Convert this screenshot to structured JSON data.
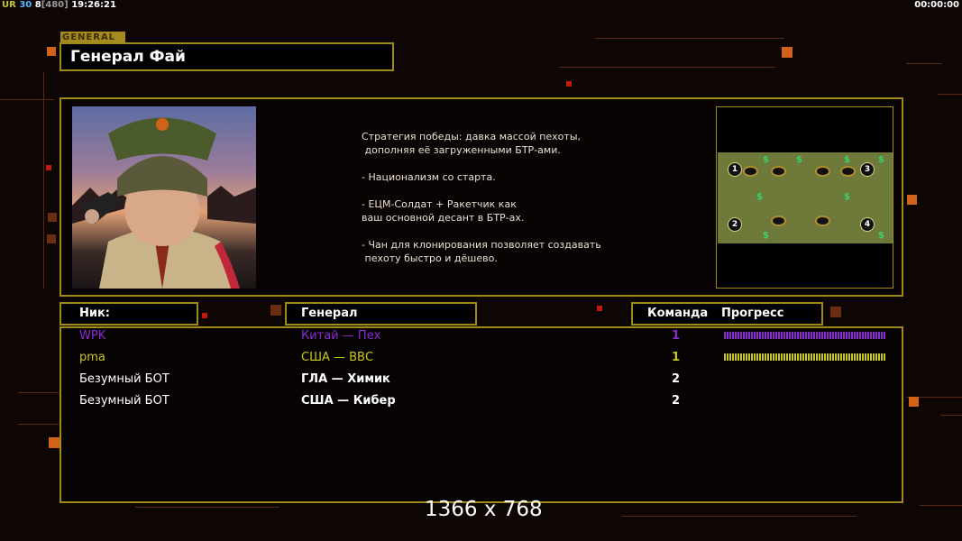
{
  "status_bar": {
    "left_a": "UR",
    "left_b": "30",
    "left_c": "8",
    "left_d": "[480]",
    "left_time": "19:26:21",
    "right_time": "00:00:00"
  },
  "general": {
    "tab_label": "GENERAL",
    "name": "Генерал Фай",
    "description": "Стратегия победы: давка массой пехоты,\n дополняя её загруженными БТР-ами.\n\n- Национализм со старта.\n\n- ЕЦМ-Солдат + Ракетчик как\nваш основной десант в БТР-ах.\n\n- Чан для клонирования позволяет создавать\n пехоту быстро и дёшево."
  },
  "map": {
    "slots": [
      "1",
      "2",
      "3",
      "4"
    ],
    "money_symbol": "$"
  },
  "table": {
    "headers": {
      "nick": "Ник:",
      "general": "Генерал",
      "team": "Команда",
      "progress": "Прогресс"
    },
    "rows": [
      {
        "nick": "WPK",
        "general": "Китай — Пех",
        "team": "1",
        "color": "#8a2bd6",
        "progress": 1.0
      },
      {
        "nick": "pma",
        "general": "США — ВВС",
        "team": "1",
        "color": "#c8c81e",
        "progress": 1.0
      },
      {
        "nick": "Безумный БОТ",
        "general": "ГЛА — Химик",
        "team": "2",
        "color": "#ffffff",
        "progress": null
      },
      {
        "nick": "Безумный БОТ",
        "general": "США — Кибер",
        "team": "2",
        "color": "#ffffff",
        "progress": null
      }
    ]
  },
  "overlay": {
    "resolution": "1366 x 768"
  },
  "colors": {
    "gold": "#a08a1a",
    "accent_orange": "#d2611a"
  }
}
